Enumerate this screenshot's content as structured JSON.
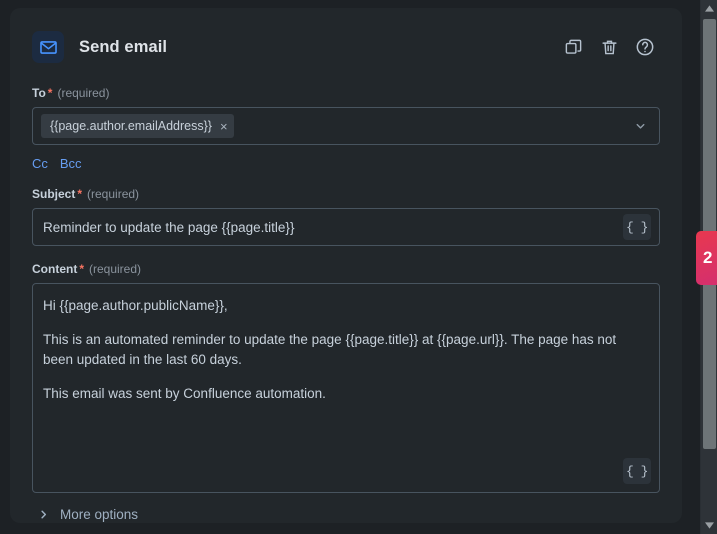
{
  "header": {
    "title": "Send email",
    "icon": "envelope-icon",
    "actions": [
      {
        "name": "duplicate-icon",
        "label": "Duplicate"
      },
      {
        "name": "delete-icon",
        "label": "Delete"
      },
      {
        "name": "help-icon",
        "label": "Help"
      }
    ]
  },
  "fields": {
    "to": {
      "label": "To",
      "required_star": "*",
      "required_text": "(required)",
      "chip_value": "{{page.author.emailAddress}}",
      "chip_remove": "×",
      "dropdown_icon": "chevron-down-icon"
    },
    "cc": {
      "label": "Cc"
    },
    "bcc": {
      "label": "Bcc"
    },
    "subject": {
      "label": "Subject",
      "required_star": "*",
      "required_text": "(required)",
      "value": "Reminder to update the page {{page.title}}",
      "smart_values_button": "{ }"
    },
    "content": {
      "label": "Content",
      "required_star": "*",
      "required_text": "(required)",
      "paragraphs": [
        "Hi {{page.author.publicName}},",
        "This is an automated reminder to update the page {{page.title}} at {{page.url}}. The page has not been updated in the last 60 days.",
        "This email was sent by Confluence automation."
      ],
      "smart_values_button": "{ }"
    }
  },
  "more_options": {
    "label": "More options",
    "icon": "chevron-right-icon"
  },
  "scrollbar": {
    "up_icon": "triangle-up-icon",
    "down_icon": "triangle-down-icon",
    "thumb": "scrollbar-thumb"
  },
  "feedback_tab": {
    "label": "2"
  },
  "colors": {
    "panel": "#22272b",
    "page": "#1d2125",
    "accent_link": "#669df1",
    "required": "#f87462",
    "icon_blue": "#4794ff",
    "feedback_start": "#e8384f",
    "feedback_end": "#d42f6e"
  }
}
